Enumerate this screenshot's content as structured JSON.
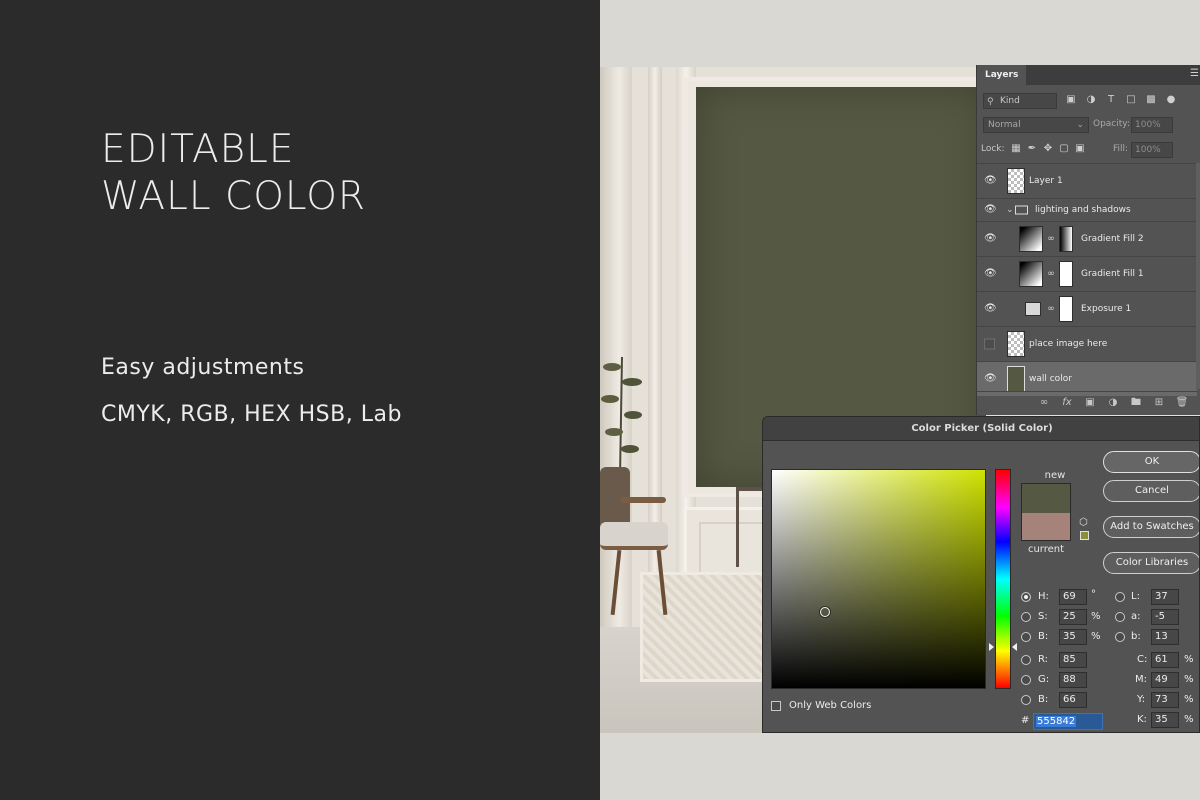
{
  "promo": {
    "headline_line1": "EDITABLE",
    "headline_line2": "WALL COLOR",
    "subline1": "Easy adjustments",
    "subline2": "CMYK, RGB, HEX HSB, Lab"
  },
  "layers_panel": {
    "tab_label": "Layers",
    "menu_icon": "hamburger-icon",
    "filter": {
      "kind_label": "Kind"
    },
    "blend_mode": "Normal",
    "opacity_label": "Opacity:",
    "opacity_value": "100%",
    "lock_label": "Lock:",
    "fill_label": "Fill:",
    "fill_value": "100%",
    "layers": [
      {
        "name": "Layer 1",
        "visible": true
      },
      {
        "name": "lighting and shadows",
        "visible": true,
        "group": true
      },
      {
        "name": "Gradient Fill 2",
        "visible": true
      },
      {
        "name": "Gradient Fill 1",
        "visible": true
      },
      {
        "name": "Exposure 1",
        "visible": true
      },
      {
        "name": "place image here",
        "visible": false
      },
      {
        "name": "wall color",
        "visible": true,
        "selected": true
      }
    ]
  },
  "color_picker": {
    "title": "Color Picker (Solid Color)",
    "new_label": "new",
    "current_label": "current",
    "new_color": "#555842",
    "current_color": "#a5837a",
    "buttons": {
      "ok": "OK",
      "cancel": "Cancel",
      "add_to_swatches": "Add to Swatches",
      "color_libraries": "Color Libraries"
    },
    "hsb": {
      "h_label": "H:",
      "h_value": "69",
      "h_unit": "°",
      "s_label": "S:",
      "s_value": "25",
      "s_unit": "%",
      "b_label": "B:",
      "b_value": "35",
      "b_unit": "%"
    },
    "rgb": {
      "r_label": "R:",
      "r_value": "85",
      "g_label": "G:",
      "g_value": "88",
      "b_label": "B:",
      "b_value": "66"
    },
    "lab": {
      "l_label": "L:",
      "l_value": "37",
      "a_label": "a:",
      "a_value": "-5",
      "b_label": "b:",
      "b_value": "13"
    },
    "cmyk": {
      "c_label": "C:",
      "c_value": "61",
      "m_label": "M:",
      "m_value": "49",
      "y_label": "Y:",
      "y_value": "73",
      "k_label": "K:",
      "k_value": "35",
      "unit": "%"
    },
    "hex_label": "#",
    "hex_value": "555842",
    "only_web_colors": "Only Web Colors",
    "selected_hue_fraction": 0.19,
    "saturation_fraction": 0.25,
    "brightness_fraction": 0.35
  }
}
